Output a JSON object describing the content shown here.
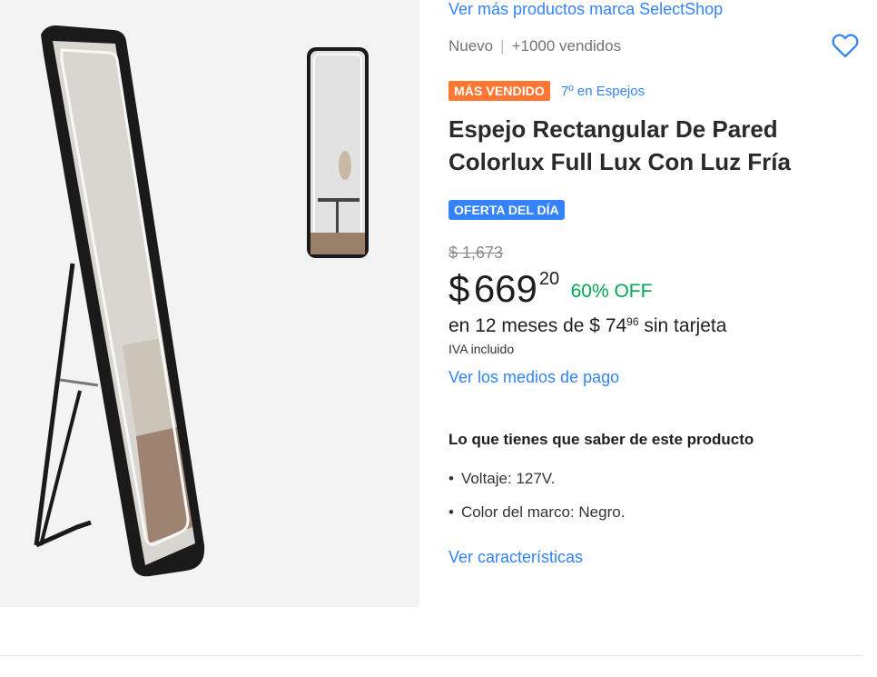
{
  "brand_link": "Ver más productos marca SelectShop",
  "condition": "Nuevo",
  "sold": "+1000 vendidos",
  "badges": {
    "bestseller": "MÁS VENDIDO",
    "rank": "7º en Espejos"
  },
  "title": "Espejo Rectangular De Pared Colorlux Full Lux Con Luz Fría",
  "deal_badge": "OFERTA DEL DÍA",
  "price": {
    "original": "$ 1,673",
    "currency": "$",
    "integer": "669",
    "cents": "20",
    "discount": "60% OFF"
  },
  "installments": {
    "prefix": "en 12 meses de",
    "currency": "$",
    "integer": "74",
    "cents": "96",
    "suffix": "sin tarjeta"
  },
  "tax_note": "IVA incluido",
  "payment_link": "Ver los medios de pago",
  "highlights": {
    "title": "Lo que tienes que saber de este producto",
    "items": [
      "Voltaje: 127V.",
      "Color del marco: Negro."
    ]
  },
  "features_link": "Ver características",
  "icons": {
    "favorite": "heart-outline-icon"
  },
  "colors": {
    "accent": "#3483fa",
    "bestseller": "#ff7733",
    "discount": "#00a650"
  }
}
